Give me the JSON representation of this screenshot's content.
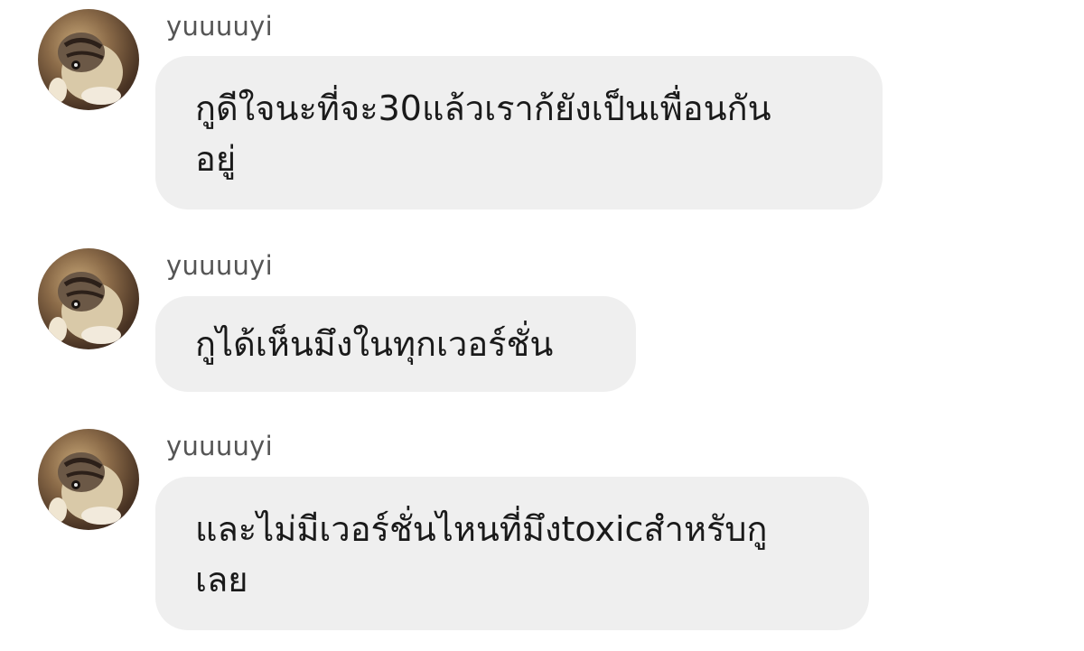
{
  "messages": [
    {
      "username": "yuuuuyi",
      "avatar_icon": "cat-avatar-icon",
      "lines": [
        "กูดีใจนะที่จะ30แล้วเราก้ยังเป็นเพื่อนกัน",
        "อยู่"
      ]
    },
    {
      "username": "yuuuuyi",
      "avatar_icon": "cat-avatar-icon",
      "lines": [
        "กูได้เห็นมึงในทุกเวอร์ชั่น"
      ]
    },
    {
      "username": "yuuuuyi",
      "avatar_icon": "cat-avatar-icon",
      "lines": [
        "และไม่มีเวอร์ชั่นไหนที่มึงtoxicสำหรับกู",
        "เลย"
      ]
    }
  ],
  "colors": {
    "bubble_background": "#efefef",
    "username_text": "#555555",
    "message_text": "#1a1a1a",
    "page_background": "#ffffff"
  }
}
